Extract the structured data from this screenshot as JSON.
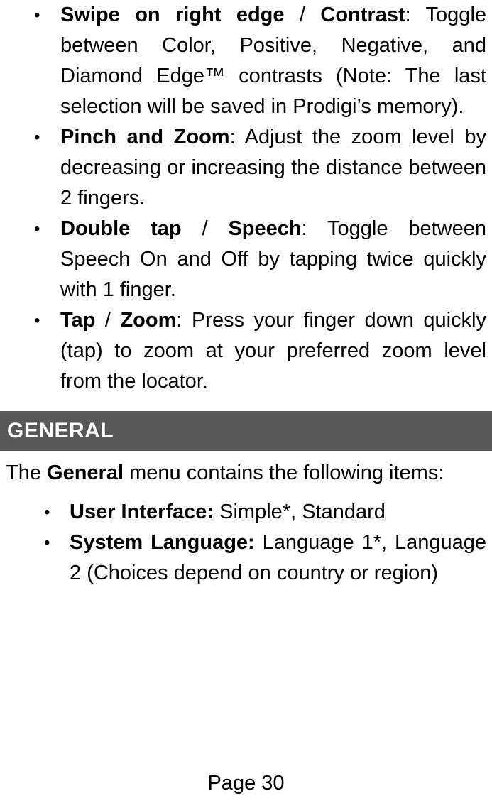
{
  "document": {
    "page_label": "Page 30"
  },
  "gesture_list": {
    "items": [
      {
        "lead": "Swipe on right edge",
        "separator": " / ",
        "lead2": "Contrast",
        "rest": ": Toggle between Color, Positive, Negative, and Diamond Edge™ contrasts (Note: The last selection will be saved in Prodigi’s memory)."
      },
      {
        "lead": "Pinch and Zoom",
        "separator": "",
        "lead2": "",
        "rest": ": Adjust the zoom level by decreasing or increasing the distance between 2 fingers."
      },
      {
        "lead": "Double tap",
        "separator": " / ",
        "lead2": "Speech",
        "rest": ": Toggle between Speech On and Off by tapping twice quickly with 1 finger."
      },
      {
        "lead": "Tap",
        "separator": " / ",
        "lead2": "Zoom",
        "rest": ": Press your finger down quickly (tap) to zoom at your preferred zoom level from the locator."
      }
    ]
  },
  "general_section": {
    "banner_title": "GENERAL",
    "banner_bg_color": "#585858",
    "banner_text_color": "#ffffff",
    "intro_before": "The ",
    "intro_bold": "General",
    "intro_after": " menu contains the following items:",
    "items": [
      {
        "lead": "User Interface:",
        "rest": " Simple*, Standard"
      },
      {
        "lead": "System Language:",
        "rest": " Language 1*, Language 2 (Choices depend on country or region)"
      }
    ]
  }
}
